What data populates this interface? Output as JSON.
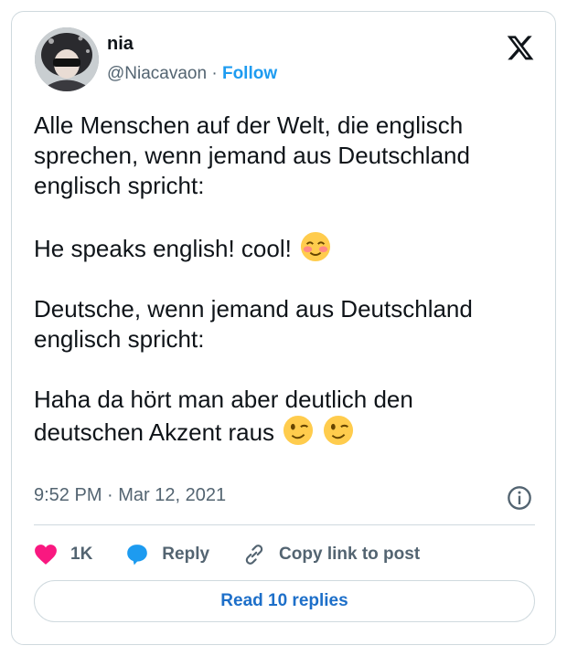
{
  "author": {
    "name": "nia",
    "handle": "@Niacavaon",
    "separator": "·",
    "follow_label": "Follow"
  },
  "tweet": {
    "lines": [
      "Alle Menschen auf der Welt, die englisch",
      "sprechen, wenn jemand aus Deutschland",
      "englisch spricht:",
      "He speaks english! cool!",
      "Deutsche, wenn jemand aus Deutschland",
      "englisch spricht:",
      "Haha da hört man aber deutlich den",
      "deutschen Akzent raus"
    ],
    "emojis": [
      "smiling-face-blushing-emoji",
      "winking-face-emoji",
      "winking-face-emoji"
    ],
    "timestamp": "9:52 PM · Mar 12, 2021"
  },
  "actions": {
    "like_count": "1K",
    "reply_label": "Reply",
    "copy_label": "Copy link to post"
  },
  "read_replies_label": "Read 10 replies",
  "colors": {
    "like": "#f91880",
    "reply": "#1d9bf0",
    "link": "#1d9bf0",
    "border": "#cfd9de",
    "muted": "#536471"
  },
  "icons": [
    "x-logo-icon",
    "info-icon",
    "heart-icon",
    "reply-bubble-icon",
    "link-icon"
  ]
}
